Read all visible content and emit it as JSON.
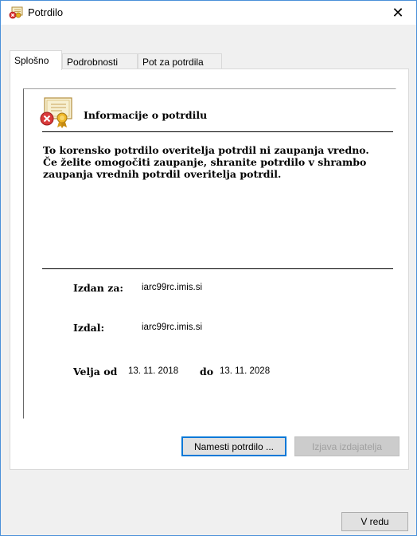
{
  "window": {
    "title": "Potrdilo",
    "close_glyph": "✕"
  },
  "tabs": [
    {
      "label": "Splošno",
      "active": true
    },
    {
      "label": "Podrobnosti",
      "active": false
    },
    {
      "label": "Pot za potrdila",
      "active": false
    }
  ],
  "info": {
    "title": "Informacije o potrdilu",
    "warning": "To korensko potrdilo overitelja potrdil ni zaupanja vredno. Če želite omogočiti zaupanje, shranite potrdilo v shrambo zaupanja vrednih potrdil overitelja potrdil.",
    "issued_to_label": "Izdan za:",
    "issued_to_value": "iarc99rc.imis.si",
    "issued_by_label": "Izdal:",
    "issued_by_value": "iarc99rc.imis.si",
    "valid_from_label": "Velja od",
    "valid_from_value": "13. 11. 2018",
    "valid_to_label": "do",
    "valid_to_value": "13. 11. 2028"
  },
  "buttons": {
    "install": "Namesti potrdilo ...",
    "issuer_statement": "Izjava izdajatelja",
    "ok": "V redu"
  },
  "icons": {
    "title_icon": "certificate-icon",
    "cert_icon": "certificate-error-icon"
  }
}
